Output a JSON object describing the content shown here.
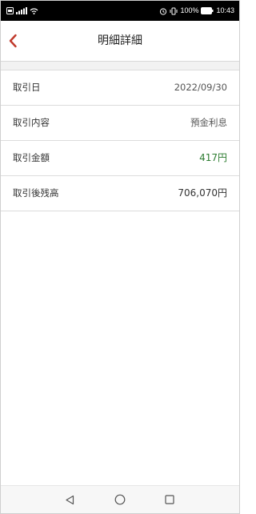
{
  "status_bar": {
    "battery": "100%",
    "time": "10:43",
    "icons": [
      "sim-icon",
      "signal-icon",
      "wifi-icon",
      "alarm-icon",
      "vibrate-icon",
      "battery-icon"
    ]
  },
  "header": {
    "title": "明細詳細",
    "back_icon": "chevron-left-icon",
    "accent_color": "#c0392b"
  },
  "details": [
    {
      "label": "取引日",
      "value": "2022/09/30"
    },
    {
      "label": "取引内容",
      "value": "預金利息"
    },
    {
      "label": "取引金額",
      "value": "417円",
      "color": "#2e7d32"
    },
    {
      "label": "取引後残高",
      "value": "706,070円"
    }
  ],
  "nav_bar": {
    "buttons": [
      "back-triangle-icon",
      "home-circle-icon",
      "recents-square-icon"
    ]
  }
}
